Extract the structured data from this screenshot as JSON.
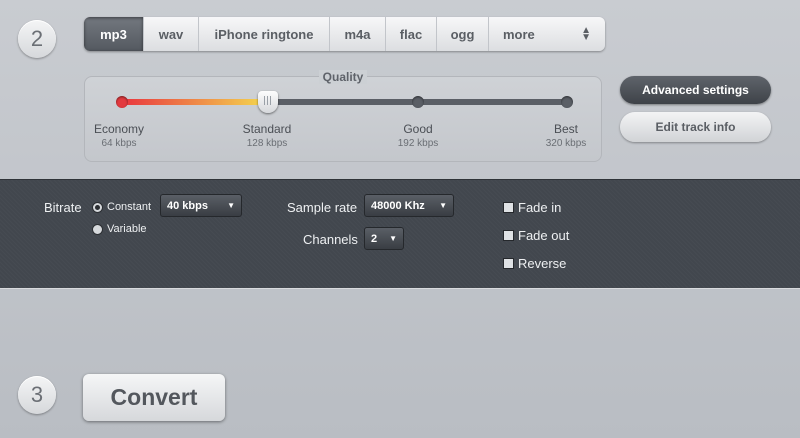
{
  "steps": {
    "step2": "2",
    "step3": "3"
  },
  "formats": {
    "tabs": [
      {
        "label": "mp3",
        "active": true
      },
      {
        "label": "wav"
      },
      {
        "label": "iPhone ringtone"
      },
      {
        "label": "m4a"
      },
      {
        "label": "flac"
      },
      {
        "label": "ogg"
      }
    ],
    "more_label": "more"
  },
  "quality": {
    "title": "Quality",
    "levels": [
      {
        "name": "Economy",
        "kbps": "64 kbps"
      },
      {
        "name": "Standard",
        "kbps": "128 kbps"
      },
      {
        "name": "Good",
        "kbps": "192 kbps"
      },
      {
        "name": "Best",
        "kbps": "320 kbps"
      }
    ],
    "selected": "Standard"
  },
  "buttons": {
    "advanced": "Advanced settings",
    "edit_track": "Edit track info",
    "convert": "Convert"
  },
  "advanced": {
    "bitrate_label": "Bitrate",
    "constant_label": "Constant",
    "variable_label": "Variable",
    "bitrate_value": "40 kbps",
    "sample_rate_label": "Sample rate",
    "sample_rate_value": "48000 Khz",
    "channels_label": "Channels",
    "channels_value": "2",
    "fade_in": "Fade in",
    "fade_out": "Fade out",
    "reverse": "Reverse"
  },
  "colors": {
    "accent_dark": "#42474e",
    "slider_start": "#e9353f",
    "slider_end": "#f4d84e"
  }
}
